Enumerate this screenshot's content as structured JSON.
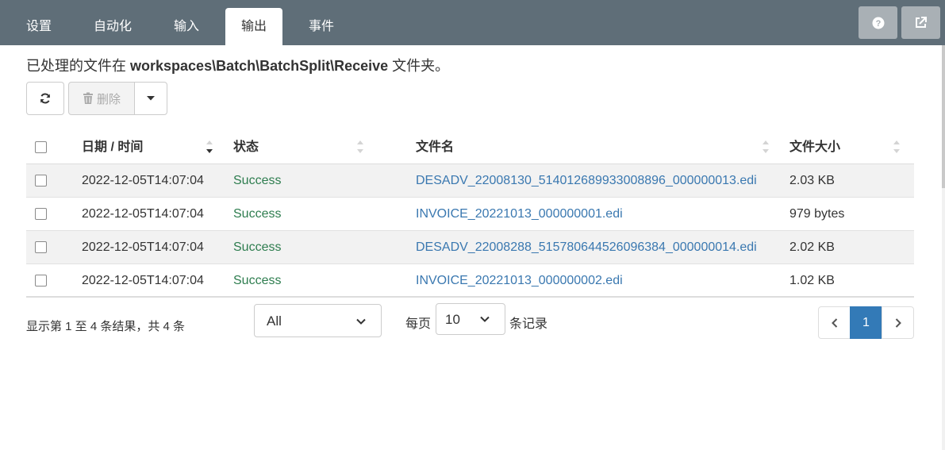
{
  "tabs": [
    {
      "label": "设置"
    },
    {
      "label": "自动化"
    },
    {
      "label": "输入"
    },
    {
      "label": "输出",
      "active": true
    },
    {
      "label": "事件"
    }
  ],
  "top_buttons": {
    "help_icon": "question-circle-icon",
    "external_icon": "external-link-icon"
  },
  "info": {
    "prefix": "已处理的文件在 ",
    "path": "workspaces\\Batch\\BatchSplit\\Receive",
    "suffix": " 文件夹。"
  },
  "toolbar": {
    "delete_label": "删除",
    "refresh_icon": "refresh-icon",
    "trash_icon": "trash-icon",
    "caret_icon": "caret-down-icon"
  },
  "table": {
    "columns": [
      "日期 / 时间",
      "状态",
      "文件名",
      "文件大小"
    ],
    "rows": [
      {
        "date": "2022-12-05T14:07:04",
        "status": "Success",
        "file": "DESADV_22008130_514012689933008896_000000013.edi",
        "size": "2.03 KB"
      },
      {
        "date": "2022-12-05T14:07:04",
        "status": "Success",
        "file": "INVOICE_20221013_000000001.edi",
        "size": "979 bytes"
      },
      {
        "date": "2022-12-05T14:07:04",
        "status": "Success",
        "file": "DESADV_22008288_515780644526096384_000000014.edi",
        "size": "2.02 KB"
      },
      {
        "date": "2022-12-05T14:07:04",
        "status": "Success",
        "file": "INVOICE_20221013_000000002.edi",
        "size": "1.02 KB"
      }
    ]
  },
  "footer": {
    "summary": "显示第 1 至 4 条结果，共 4 条",
    "filter_value": "All",
    "per_page_label": "每页",
    "page_size": "10",
    "records_label": "条记录",
    "current_page": "1"
  },
  "colors": {
    "topbar": "#5f6e78",
    "success": "#2e7d4f",
    "link": "#3a78b0",
    "pager_active": "#337ab7"
  }
}
